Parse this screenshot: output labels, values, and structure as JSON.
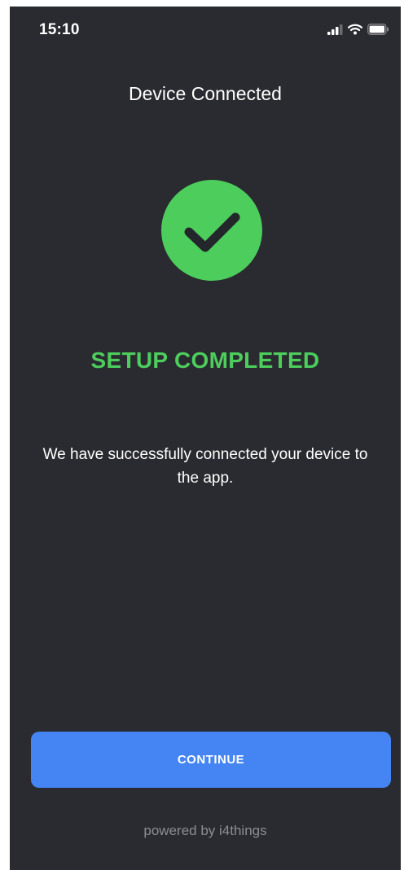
{
  "status_bar": {
    "time": "15:10",
    "icons": [
      "cellular-signal-icon",
      "wifi-icon",
      "battery-icon"
    ]
  },
  "header": {
    "title": "Device Connected"
  },
  "result": {
    "icon": "checkmark-circle-icon",
    "heading": "SETUP COMPLETED",
    "message": "We have successfully connected your device to the app."
  },
  "actions": {
    "continue_label": "CONTINUE"
  },
  "footer": {
    "powered_by": "powered by i4things"
  },
  "colors": {
    "background": "#2a2b30",
    "success_green": "#4ccd5c",
    "button_blue": "#4485f3",
    "footer_text": "#8c8d92"
  }
}
